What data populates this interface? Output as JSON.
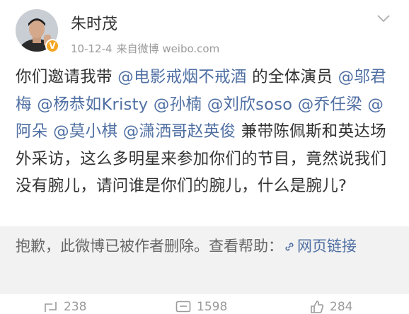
{
  "post": {
    "author": {
      "name": "朱时茂"
    },
    "time": "10-12-4",
    "source": "来自微博 weibo.com",
    "verified_badge": "V",
    "content": [
      {
        "type": "text",
        "text": "你们邀请我带 "
      },
      {
        "type": "mention",
        "text": "@电影戒烟不戒酒"
      },
      {
        "type": "text",
        "text": " 的全体演员 "
      },
      {
        "type": "mention",
        "text": "@邬君梅"
      },
      {
        "type": "text",
        "text": " "
      },
      {
        "type": "mention",
        "text": "@杨恭如Kristy"
      },
      {
        "type": "text",
        "text": " "
      },
      {
        "type": "mention",
        "text": "@孙楠"
      },
      {
        "type": "text",
        "text": " "
      },
      {
        "type": "mention",
        "text": "@刘欣soso"
      },
      {
        "type": "text",
        "text": " "
      },
      {
        "type": "mention",
        "text": "@乔任梁"
      },
      {
        "type": "text",
        "text": " "
      },
      {
        "type": "mention",
        "text": "@阿朵"
      },
      {
        "type": "text",
        "text": " "
      },
      {
        "type": "mention",
        "text": "@莫小棋"
      },
      {
        "type": "text",
        "text": " "
      },
      {
        "type": "mention",
        "text": "@潇洒哥赵英俊"
      },
      {
        "type": "text",
        "text": " 兼带陈佩斯和英达场外采访，这么多明星来参加你们的节目，竟然说我们没有腕儿，请问谁是你们的腕儿，什么是腕儿?"
      }
    ],
    "deleted_notice": {
      "text": "抱歉，此微博已被作者删除。查看帮助：",
      "link_text": "网页链接"
    },
    "actions": {
      "repost": "238",
      "comment": "1598",
      "like": "284"
    }
  },
  "icons": {
    "menu": "chevron-down-icon",
    "link": "link-icon",
    "repost": "repost-icon",
    "comment": "comment-icon",
    "like": "thumbs-up-icon"
  },
  "colors": {
    "link": "#4f6fa3",
    "text": "#333333",
    "meta": "#9a9a9a",
    "deleted_bg": "#f2f2f2",
    "badge": "#f5a623"
  }
}
